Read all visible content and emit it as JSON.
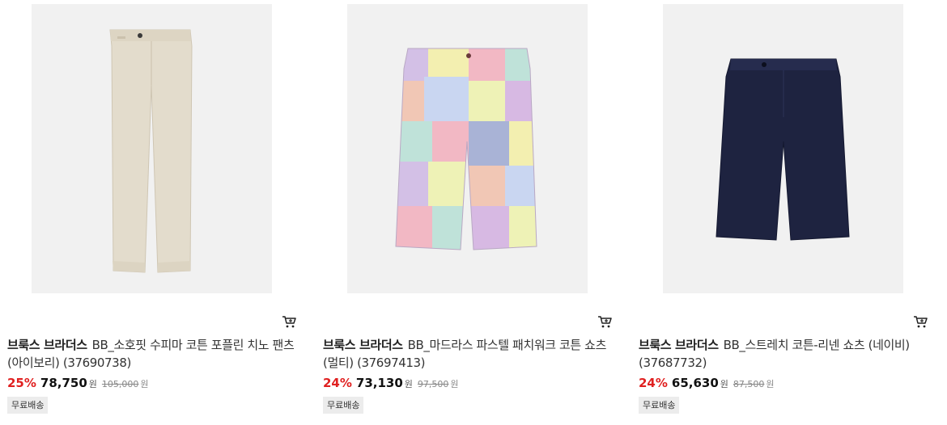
{
  "products": [
    {
      "brand": "브룩스 브라더스",
      "name": "BB_소호핏 수피마 코튼 포플린 치노 팬츠 (아이보리) (37690738)",
      "discount": "25%",
      "price": "78,750",
      "price_unit": "원",
      "original_price": "105,000",
      "original_unit": "원",
      "badge": "무료배송",
      "image_icon": "chino-pants-image",
      "color": "#e3dccc"
    },
    {
      "brand": "브룩스 브라더스",
      "name": "BB_마드라스 파스텔 패치워크 코튼 쇼츠 (멀티) (37697413)",
      "discount": "24%",
      "price": "73,130",
      "price_unit": "원",
      "original_price": "97,500",
      "original_unit": "원",
      "badge": "무료배송",
      "image_icon": "patchwork-shorts-image",
      "color": "#d9c4e0"
    },
    {
      "brand": "브룩스 브라더스",
      "name": "BB_스트레치 코튼-리넨 쇼츠 (네이비) (37687732)",
      "discount": "24%",
      "price": "65,630",
      "price_unit": "원",
      "original_price": "87,500",
      "original_unit": "원",
      "badge": "무료배송",
      "image_icon": "navy-shorts-image",
      "color": "#1e2340"
    }
  ],
  "colors": {
    "discount": "#e02020",
    "thumb_bg": "#f1f1f1"
  }
}
